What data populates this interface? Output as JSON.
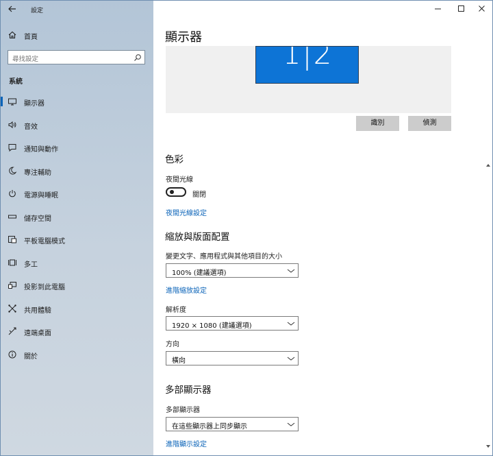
{
  "window": {
    "app_title": "設定"
  },
  "sidebar": {
    "home_label": "首頁",
    "search_placeholder": "尋找設定",
    "section_label": "系統",
    "items": [
      {
        "label": "顯示器",
        "icon": "monitor-icon"
      },
      {
        "label": "音效",
        "icon": "speaker-icon"
      },
      {
        "label": "通知與動作",
        "icon": "notification-icon"
      },
      {
        "label": "專注輔助",
        "icon": "moon-icon"
      },
      {
        "label": "電源與睡眠",
        "icon": "power-icon"
      },
      {
        "label": "儲存空間",
        "icon": "storage-icon"
      },
      {
        "label": "平板電腦模式",
        "icon": "tablet-icon"
      },
      {
        "label": "多工",
        "icon": "multitask-icon"
      },
      {
        "label": "投影到此電腦",
        "icon": "project-icon"
      },
      {
        "label": "共用體驗",
        "icon": "share-icon"
      },
      {
        "label": "遠端桌面",
        "icon": "remote-icon"
      },
      {
        "label": "關於",
        "icon": "info-icon"
      }
    ]
  },
  "main": {
    "title": "顯示器",
    "monitor_number": "1|2",
    "identify_button": "識別",
    "detect_button": "偵測",
    "color_section": "色彩",
    "night_light_label": "夜間光線",
    "night_light_state": "關閉",
    "night_light_settings_link": "夜間光線設定",
    "scale_section": "縮放與版面配置",
    "scale_label": "變更文字、應用程式與其他項目的大小",
    "scale_value": "100% (建議選項)",
    "advanced_scale_link": "進階縮放設定",
    "resolution_label": "解析度",
    "resolution_value": "1920 × 1080 (建議選項)",
    "orientation_label": "方向",
    "orientation_value": "橫向",
    "multi_section": "多部顯示器",
    "multi_label": "多部顯示器",
    "multi_value": "在這些顯示器上同步顯示",
    "advanced_display_link": "進階顯示設定"
  },
  "colors": {
    "accent": "#0a63b8",
    "monitor_fill": "#0d74d6",
    "button_bg": "#cccccc"
  }
}
